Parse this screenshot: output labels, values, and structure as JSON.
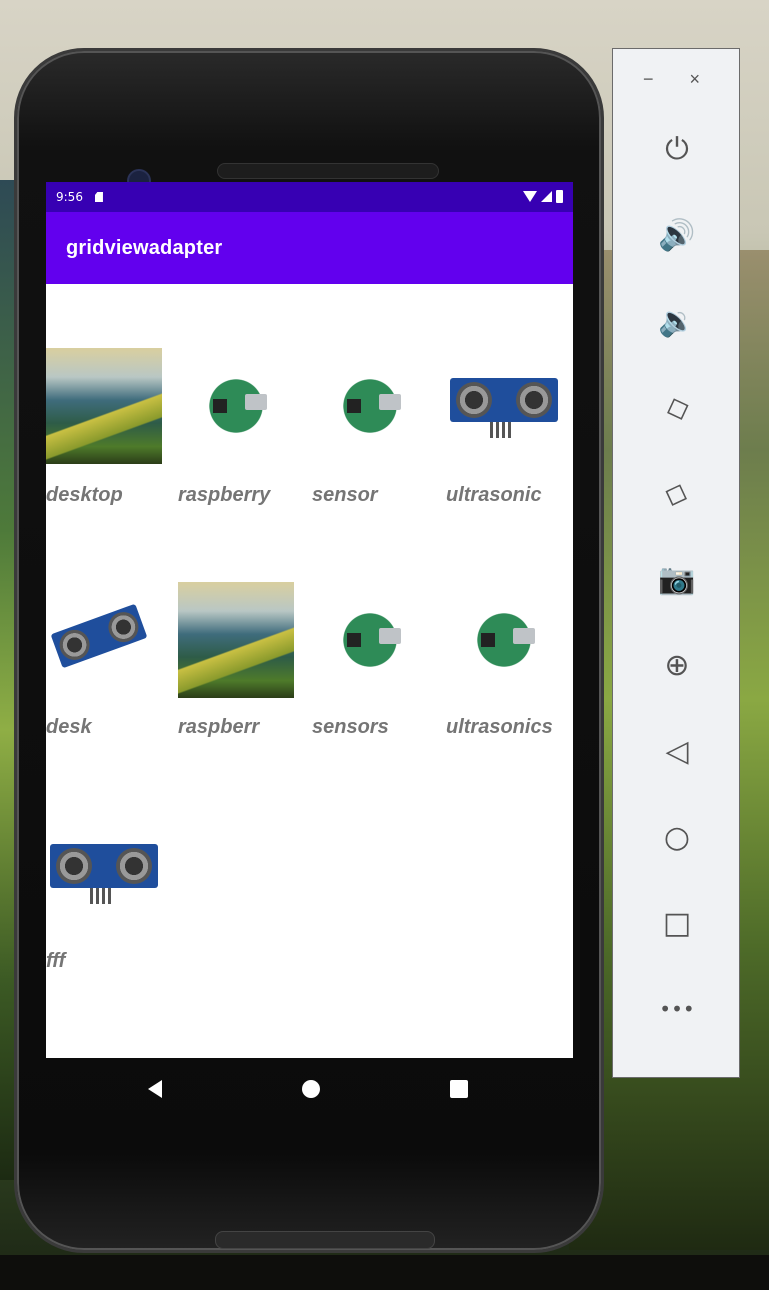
{
  "status_bar": {
    "time": "9:56"
  },
  "app_bar": {
    "title": "gridviewadapter"
  },
  "grid_items": [
    {
      "label": "desktop",
      "image": "mountain"
    },
    {
      "label": "raspberry",
      "image": "raspberry-pi"
    },
    {
      "label": "sensor",
      "image": "raspberry-pi"
    },
    {
      "label": "ultrasonic",
      "image": "ultrasonic-sensor"
    },
    {
      "label": "desk",
      "image": "ultrasonic-sensor"
    },
    {
      "label": "raspberr",
      "image": "mountain"
    },
    {
      "label": "sensors",
      "image": "raspberry-pi"
    },
    {
      "label": "ultrasonics",
      "image": "raspberry-pi"
    },
    {
      "label": "fff",
      "image": "ultrasonic-sensor"
    }
  ],
  "side_panel": {
    "minimize": "−",
    "close": "×",
    "buttons": [
      {
        "name": "power-icon",
        "glyph": "⏻"
      },
      {
        "name": "volume-up-icon",
        "glyph": "🔊"
      },
      {
        "name": "volume-down-icon",
        "glyph": "🔉"
      },
      {
        "name": "rotate-left-icon",
        "glyph": "◇"
      },
      {
        "name": "rotate-right-icon",
        "glyph": "◇"
      },
      {
        "name": "screenshot-icon",
        "glyph": "📷"
      },
      {
        "name": "zoom-icon",
        "glyph": "⊕"
      },
      {
        "name": "back-icon",
        "glyph": "◁"
      },
      {
        "name": "home-icon",
        "glyph": "○"
      },
      {
        "name": "overview-icon",
        "glyph": "□"
      },
      {
        "name": "more-icon",
        "glyph": "•••"
      }
    ]
  }
}
